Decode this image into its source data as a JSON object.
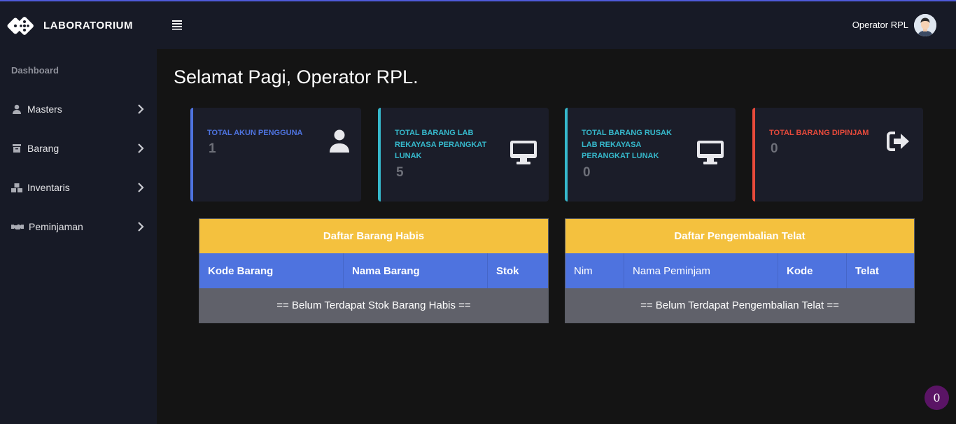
{
  "brand": {
    "title": "LABORATORIUM",
    "icon": "dice-logo-icon"
  },
  "sidebar": {
    "heading": "Dashboard",
    "items": [
      {
        "label": "Masters",
        "icon": "user-icon"
      },
      {
        "label": "Barang",
        "icon": "box-icon"
      },
      {
        "label": "Inventaris",
        "icon": "cubes-icon"
      },
      {
        "label": "Peminjaman",
        "icon": "handshake-icon"
      }
    ]
  },
  "topbar": {
    "user_name": "Operator RPL",
    "menu_icon": "hamburger-icon"
  },
  "greeting": "Selamat Pagi, Operator RPL.",
  "cards": [
    {
      "label": "TOTAL AKUN PENGGUNA",
      "value": "1",
      "icon": "user-icon",
      "color": "#4e73df"
    },
    {
      "label": "TOTAL BARANG LAB REKAYASA PERANGKAT LUNAK",
      "value": "5",
      "icon": "desktop-icon",
      "color": "#36b9cc"
    },
    {
      "label": "TOTAL BARANG RUSAK LAB REKAYASA PERANGKAT LUNAK",
      "value": "0",
      "icon": "desktop-icon",
      "color": "#36b9cc"
    },
    {
      "label": "TOTAL BARANG DIPINJAM",
      "value": "0",
      "icon": "sign-out-icon",
      "color": "#e74a3b"
    }
  ],
  "tables": [
    {
      "title": "Daftar Barang Habis",
      "headers": [
        "Kode Barang",
        "Nama Barang",
        "Stok"
      ],
      "empty": "== Belum Terdapat Stok Barang Habis =="
    },
    {
      "title": "Daftar Pengembalian Telat",
      "headers": [
        "Nim",
        "Nama Peminjam",
        "Kode",
        "Telat"
      ],
      "empty": "== Belum Terdapat Pengembalian Telat =="
    }
  ],
  "notification_badge": "0",
  "colors": {
    "primary": "#4e73df",
    "info": "#36b9cc",
    "danger": "#e74a3b",
    "warning": "#f4c13e",
    "sidebar": "#171a26"
  }
}
